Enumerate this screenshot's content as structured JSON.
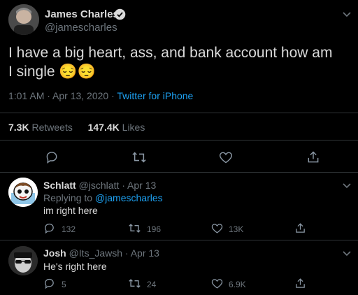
{
  "main_tweet": {
    "author_name": "James Charles",
    "handle": "@jamescharles",
    "text": "I have a big heart, ass, and bank account how am I single",
    "emoji": "😔😔",
    "time": "1:01 AM · Apr 13, 2020 · ",
    "source": "Twitter for iPhone",
    "retweets_count": "7.3K",
    "retweets_label": "Retweets",
    "likes_count": "147.4K",
    "likes_label": "Likes"
  },
  "replies": [
    {
      "author_name": "Schlatt",
      "handle_date": "@jschlatt · Apr 13",
      "replying_prefix": "Replying to ",
      "replying_handle": "@jamescharles",
      "text": "im right here",
      "reply_count": "132",
      "retweet_count": "196",
      "like_count": "13K"
    },
    {
      "author_name": "Josh",
      "handle_date": "@Its_Jawsh · Apr 13",
      "text": "He's right here",
      "reply_count": "5",
      "retweet_count": "24",
      "like_count": "6.9K"
    }
  ],
  "icons": {
    "verified": "verified-badge-icon",
    "chevron": "chevron-down-icon",
    "reply": "reply-icon",
    "retweet": "retweet-icon",
    "like": "heart-icon",
    "share": "share-icon"
  },
  "colors": {
    "background": "#000000",
    "text": "#d9d9d9",
    "muted": "#6e767d",
    "accent": "#1da1f2",
    "divider": "#2f3336"
  }
}
